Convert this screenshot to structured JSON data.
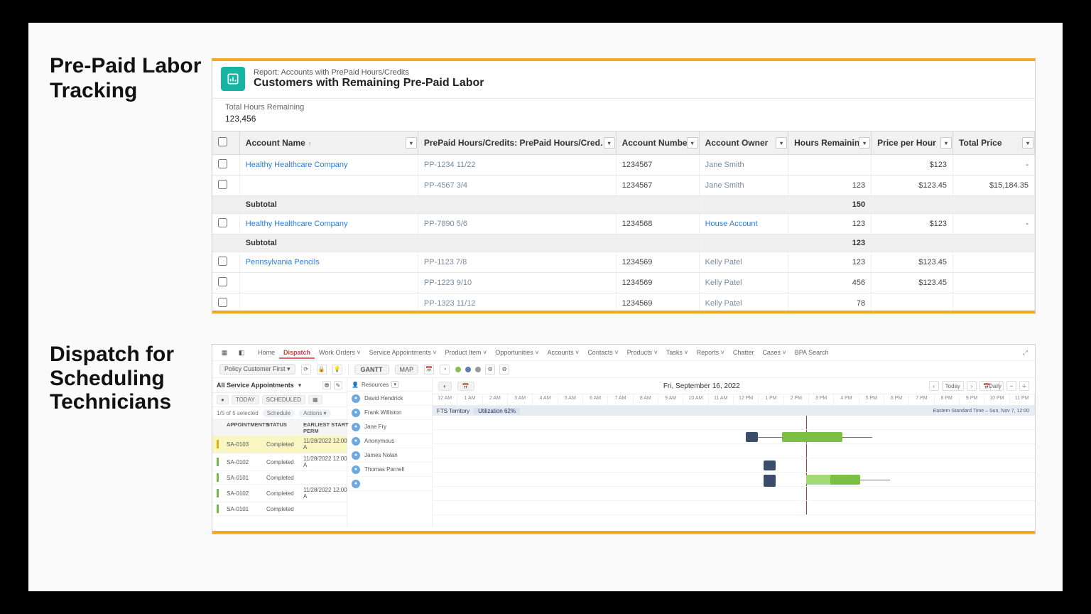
{
  "section1_title": "Pre-Paid Labor Tracking",
  "section2_title": "Dispatch for Scheduling Technicians",
  "report": {
    "type_line": "Report: Accounts with PrePaid Hours/Credits",
    "title": "Customers with Remaining Pre-Paid Labor",
    "summary_label": "Total Hours Remaining",
    "summary_value": "123,456",
    "columns": {
      "account_name": "Account Name",
      "pp_name": "PrePaid Hours/Credits: PrePaid Hours/Credits Name",
      "account_number": "Account Number",
      "account_owner": "Account Owner",
      "hours_remaining": "Hours Remaining",
      "price_per_hour": "Price per Hour",
      "total_price": "Total Price"
    },
    "rows": [
      {
        "type": "data",
        "account": "Healthy Healthcare Company",
        "pp": "PP-1234 11/22",
        "num": "1234567",
        "owner": "Jane Smith",
        "hours": "",
        "pph": "$123",
        "total": "-"
      },
      {
        "type": "data",
        "account": "",
        "pp": "PP-4567 3/4",
        "num": "1234567",
        "owner": "Jane Smith",
        "hours": "123",
        "pph": "$123.45",
        "total": "$15,184.35"
      },
      {
        "type": "subtotal",
        "label": "Subtotal",
        "hours": "150"
      },
      {
        "type": "data",
        "account": "Healthy Healthcare Company",
        "pp": "PP-7890 5/6",
        "num": "1234568",
        "owner": "House Account",
        "owner_strong": true,
        "hours": "123",
        "pph": "$123",
        "total": "-"
      },
      {
        "type": "subtotal",
        "label": "Subtotal",
        "hours": "123"
      },
      {
        "type": "data",
        "account": "Pennsylvania Pencils",
        "pp": "PP-1123 7/8",
        "num": "1234569",
        "owner": "Kelly Patel",
        "hours": "123",
        "pph": "$123.45",
        "total": ""
      },
      {
        "type": "data",
        "account": "",
        "pp": "PP-1223 9/10",
        "num": "1234569",
        "owner": "Kelly Patel",
        "hours": "456",
        "pph": "$123.45",
        "total": ""
      },
      {
        "type": "data",
        "account": "",
        "pp": "PP-1323 11/12",
        "num": "1234569",
        "owner": "Kelly Patel",
        "hours": "78",
        "pph": "",
        "total": ""
      }
    ]
  },
  "dispatch": {
    "nav": [
      "Home",
      "Dispatch",
      "Work Orders",
      "Service Appointments",
      "Product Item",
      "Opportunities",
      "Accounts",
      "Contacts",
      "Products",
      "Tasks",
      "Reports",
      "Chatter",
      "Cases",
      "BPA Search"
    ],
    "active_nav": "Dispatch",
    "policy_label": "Policy   Customer First",
    "view_gantt": "GANTT",
    "view_map": "MAP",
    "date_center": "Fri, September 16, 2022",
    "daily_label": "Daily",
    "today_label": "Today",
    "left": {
      "title": "All Service Appointments",
      "filter_today": "TODAY",
      "filter_sched": "SCHEDULED",
      "count_line": "1/5 of 5 selected",
      "chip_schedule": "Schedule",
      "chip_actions": "Actions",
      "col_appt": "APPOINTMENTS",
      "col_status": "STATUS",
      "col_start": "EARLIEST START PERM",
      "rows": [
        {
          "id": "SA-0103",
          "status": "Completed",
          "start": "11/28/2022 12:00 A",
          "sel": true
        },
        {
          "id": "SA-0102",
          "status": "Completed",
          "start": "11/28/2022 12:00 A",
          "sel": false
        },
        {
          "id": "SA-0101",
          "status": "Completed",
          "start": "",
          "sel": false
        },
        {
          "id": "SA-0102",
          "status": "Completed",
          "start": "11/28/2022 12:00 A",
          "sel": false
        },
        {
          "id": "SA-0101",
          "status": "Completed",
          "start": "",
          "sel": false
        }
      ]
    },
    "resources": {
      "search_placeholder": "Resources",
      "rows": [
        "David Hendrick",
        "Frank Williston",
        "Jane Fry",
        "Anonymous",
        "James Nolan",
        "Thomas Parnell",
        ""
      ]
    },
    "gantt": {
      "territory_label": "FTS Territory",
      "utilization": "Utilization 62%",
      "tz": "Eastern Standard Time – Sun, Nov 7, 12:00",
      "hours": [
        "12 AM",
        "1 AM",
        "2 AM",
        "3 AM",
        "4 AM",
        "5 AM",
        "6 AM",
        "7 AM",
        "8 AM",
        "9 AM",
        "10 AM",
        "11 AM",
        "12 PM",
        "1 PM",
        "2 PM",
        "3 PM",
        "4 PM",
        "5 PM",
        "6 PM",
        "7 PM",
        "8 PM",
        "9 PM",
        "10 PM",
        "11 PM"
      ]
    }
  }
}
